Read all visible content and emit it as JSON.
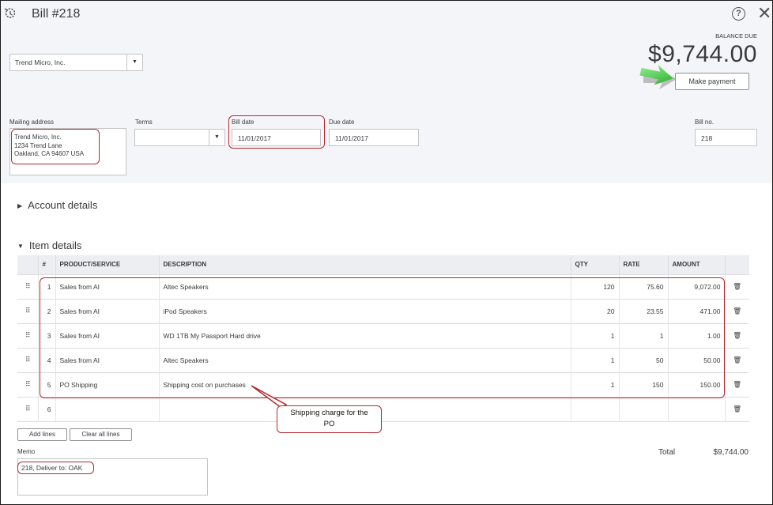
{
  "header": {
    "title": "Bill  #218",
    "balance_due_label": "BALANCE DUE",
    "balance_due": "$9,744.00",
    "make_payment_label": "Make payment"
  },
  "vendor": {
    "value": "Trend Micro, Inc."
  },
  "mailing": {
    "label": "Mailing address",
    "line1": "Trend Micro, Inc.",
    "line2": "1234 Trend Lane",
    "line3": "Oakland, CA  94607 USA"
  },
  "terms": {
    "label": "Terms",
    "value": ""
  },
  "bill_date": {
    "label": "Bill date",
    "value": "11/01/2017"
  },
  "due_date": {
    "label": "Due date",
    "value": "11/01/2017"
  },
  "bill_no": {
    "label": "Bill no.",
    "value": "218"
  },
  "sections": {
    "account_details": "Account details",
    "item_details": "Item details"
  },
  "table": {
    "headers": {
      "num": "#",
      "product": "PRODUCT/SERVICE",
      "description": "DESCRIPTION",
      "qty": "QTY",
      "rate": "RATE",
      "amount": "AMOUNT"
    },
    "rows": [
      {
        "num": "1",
        "product": "Sales from AI",
        "description": "Altec Speakers",
        "qty": "120",
        "rate": "75.60",
        "amount": "9,072.00"
      },
      {
        "num": "2",
        "product": "Sales from AI",
        "description": "iPod Speakers",
        "qty": "20",
        "rate": "23.55",
        "amount": "471.00"
      },
      {
        "num": "3",
        "product": "Sales from AI",
        "description": "WD 1TB My Passport Hard drive",
        "qty": "1",
        "rate": "1",
        "amount": "1.00"
      },
      {
        "num": "4",
        "product": "Sales from AI",
        "description": "Altec Speakers",
        "qty": "1",
        "rate": "50",
        "amount": "50.00"
      },
      {
        "num": "5",
        "product": "PO Shipping",
        "description": "Shipping cost on purchases",
        "qty": "1",
        "rate": "150",
        "amount": "150.00"
      },
      {
        "num": "6",
        "product": "",
        "description": "",
        "qty": "",
        "rate": "",
        "amount": ""
      }
    ]
  },
  "buttons": {
    "add_lines": "Add lines",
    "clear_all_lines": "Clear all lines"
  },
  "callout": {
    "line1": "Shipping charge for the",
    "line2": "PO"
  },
  "memo": {
    "label": "Memo",
    "value": "218, Deliver to: OAK"
  },
  "totals": {
    "label": "Total",
    "value": "$9,744.00"
  },
  "colors": {
    "annotation": "#b5282e",
    "arrow": "#3ec53e",
    "header_bg": "#f4f5f8"
  }
}
